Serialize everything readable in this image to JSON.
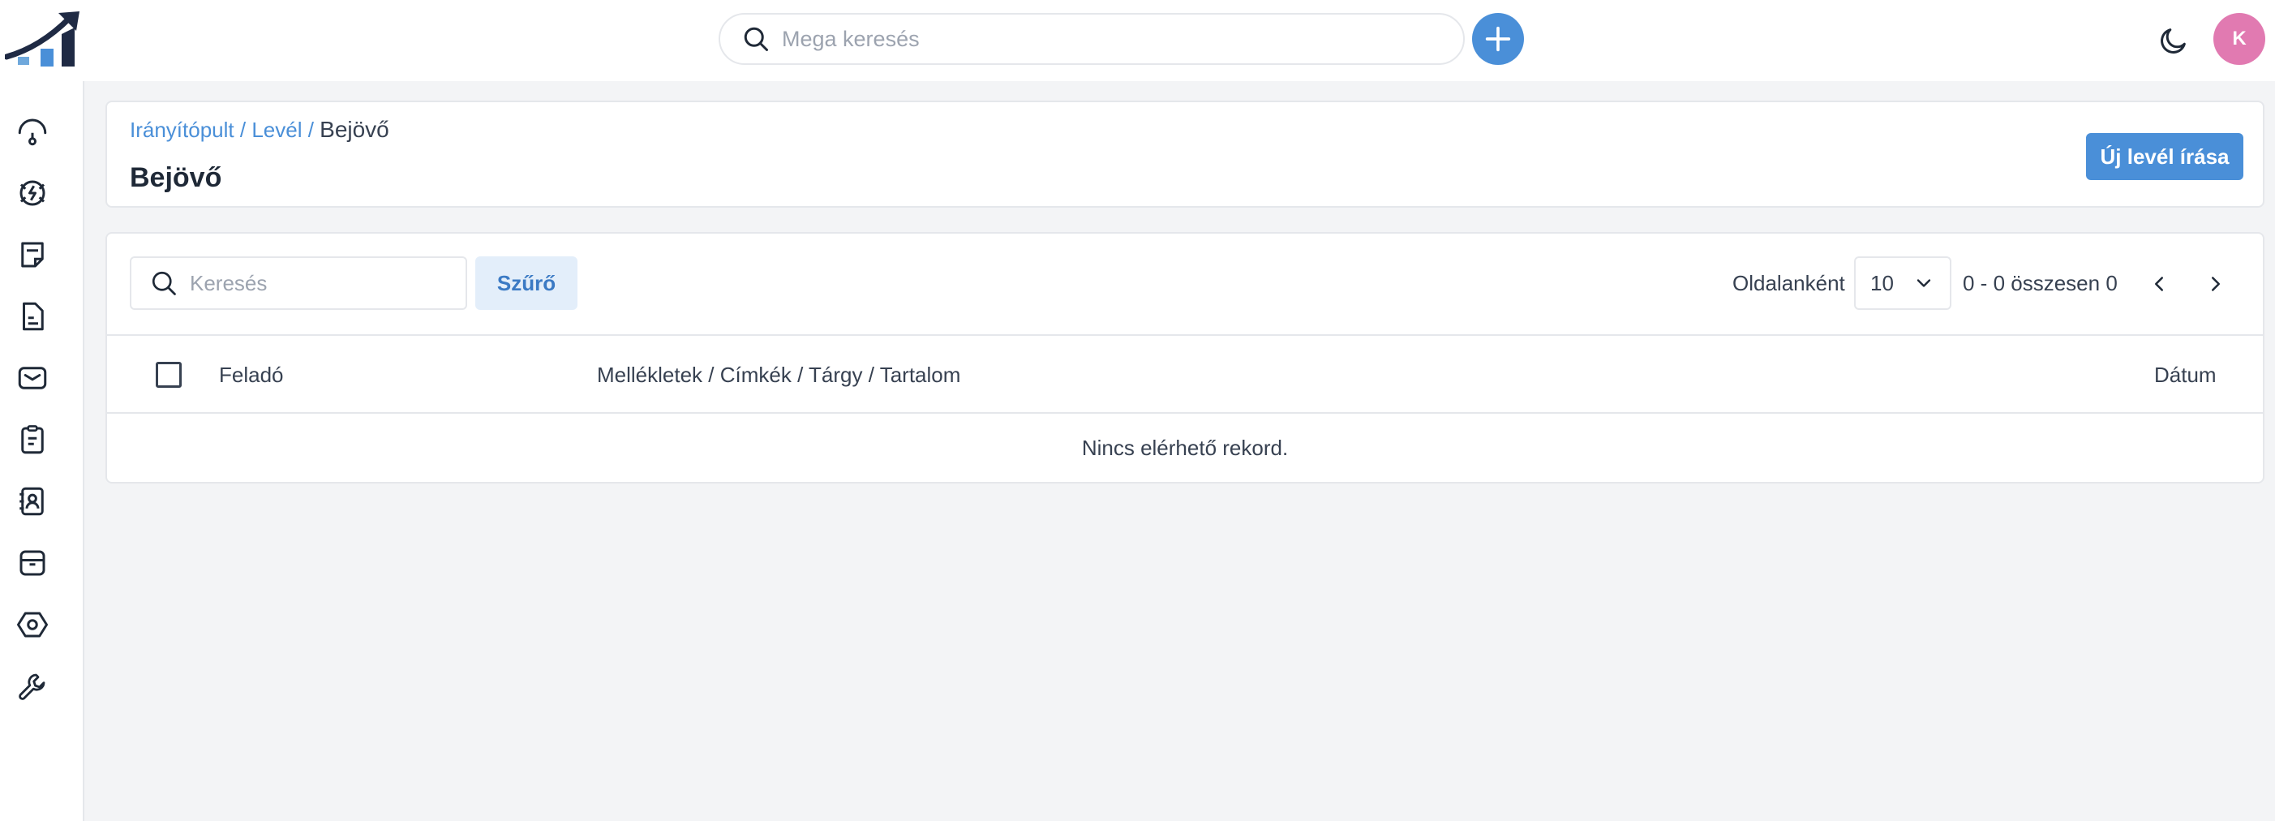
{
  "header": {
    "search_placeholder": "Mega keresés",
    "avatar_initial": "K"
  },
  "sidebar": {
    "items": [
      {
        "icon": "dashboard-gauge-icon"
      },
      {
        "icon": "lifebuoy-lightning-icon"
      },
      {
        "icon": "note-icon"
      },
      {
        "icon": "document-icon"
      },
      {
        "icon": "mail-icon"
      },
      {
        "icon": "clipboard-icon"
      },
      {
        "icon": "contacts-book-icon"
      },
      {
        "icon": "archive-box-icon"
      },
      {
        "icon": "hexagon-nut-icon"
      },
      {
        "icon": "wrench-icon"
      }
    ]
  },
  "breadcrumb": {
    "home": "Irányítópult",
    "sep1": " / ",
    "mail": "Levél",
    "sep2": " / ",
    "current": "Bejövő"
  },
  "page": {
    "title": "Bejövő",
    "new_mail_label": "Új levél írása"
  },
  "list": {
    "search_placeholder": "Keresés",
    "filter_label": "Szűrő",
    "per_page_label": "Oldalanként",
    "per_page_value": "10",
    "range_text": "0 - 0 összesen 0",
    "columns": {
      "sender": "Feladó",
      "details": "Mellékletek / Címkék / Tárgy / Tartalom",
      "date": "Dátum"
    },
    "empty_text": "Nincs elérhető rekord."
  },
  "colors": {
    "accent": "#4a8fd8",
    "avatar": "#e17ab1",
    "filter_bg": "#e3eefa"
  }
}
